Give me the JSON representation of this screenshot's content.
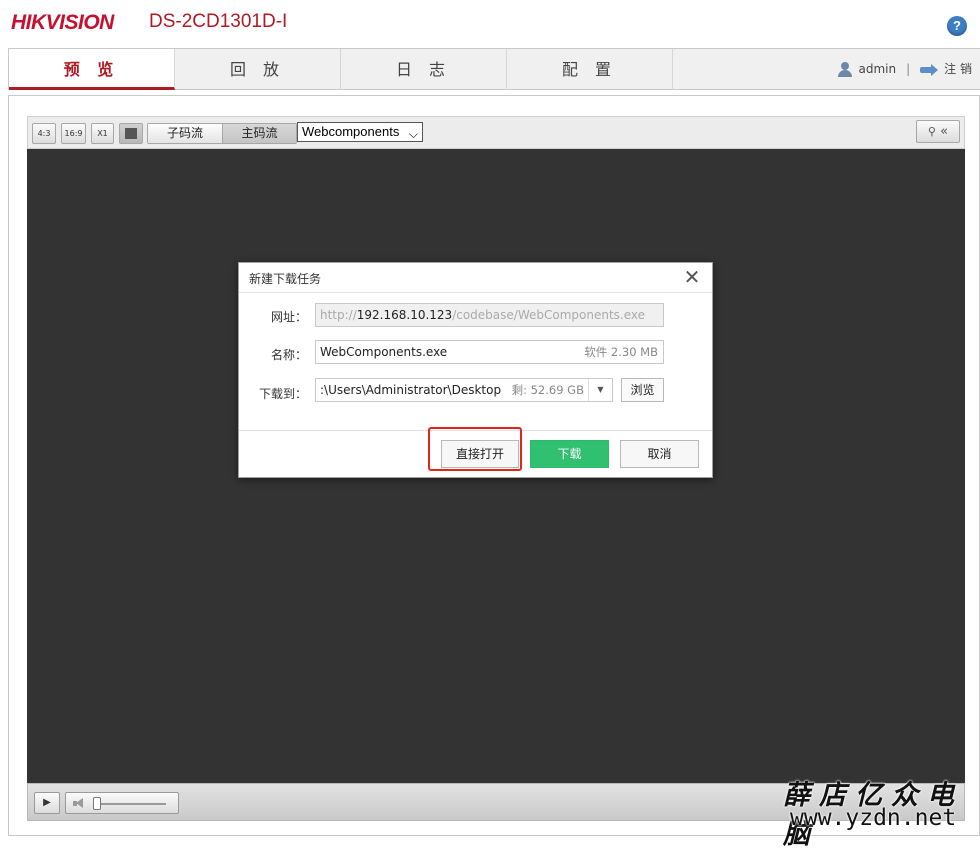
{
  "header": {
    "brand": "HIKVISION",
    "model": "DS-2CD1301D-I",
    "help_glyph": "?"
  },
  "nav": {
    "tabs": [
      {
        "label": "预 览",
        "active": true
      },
      {
        "label": "回 放",
        "active": false
      },
      {
        "label": "日 志",
        "active": false
      },
      {
        "label": "配 置",
        "active": false
      }
    ],
    "user": "admin",
    "separator": "|",
    "logout": "注 销"
  },
  "toolbar": {
    "ratio_buttons": [
      "4:3",
      "16:9",
      "X1"
    ],
    "stream_tabs": [
      "子码流",
      "主码流"
    ],
    "active_stream": "主码流",
    "plugin_select": "Webcomponents",
    "expand_glyph": "«"
  },
  "dialog": {
    "title": "新建下载任务",
    "close_glyph": "✕",
    "url_label": "网址：",
    "url_prefix": "http://",
    "url_host": "192.168.10.123",
    "url_suffix": "/codebase/WebComponents.exe",
    "name_label": "名称：",
    "name_value": "WebComponents.exe",
    "name_meta": "软件 2.30 MB",
    "path_label": "下载到：",
    "path_value": ":\\Users\\Administrator\\Desktop",
    "path_meta": "剩: 52.69 GB",
    "path_drop_glyph": "▼",
    "browse": "浏览",
    "open_direct": "直接打开",
    "download": "下载",
    "cancel": "取消"
  },
  "watermark": {
    "chinese": "薛店亿众电脑",
    "url": "www.yzdn.net"
  },
  "colors": {
    "brand_red": "#c8102e",
    "download_green": "#31c06f",
    "highlight_red": "#e1251b",
    "video_bg": "#333333"
  }
}
